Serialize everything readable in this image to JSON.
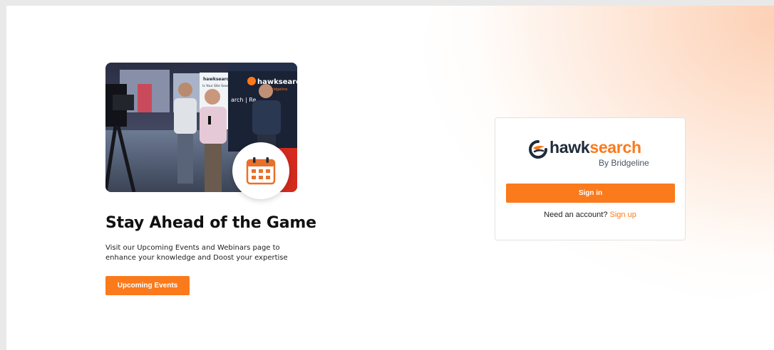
{
  "promo": {
    "title": "Stay Ahead of the Game",
    "description": "Visit our Upcoming Events and Webinars page to enhance your knowledge and Doost your expertise",
    "button_label": "Upcoming Events",
    "photo_booth_brand": "hawksearch",
    "photo_booth_sub": "By Bridgeline",
    "photo_sign_text": "Is Your Site Search Relevant?",
    "photo_banner_text": "arch | Re",
    "badge_icon": "calendar-icon"
  },
  "login": {
    "logo_word_left": "hawk",
    "logo_word_right": "search",
    "logo_sub": "By Bridgeline",
    "signin_label": "Sign in",
    "account_prompt": "Need an account?",
    "signup_label": "Sign up"
  },
  "colors": {
    "accent": "#fb7a1c",
    "logo_dark": "#1f2a3a",
    "glow": "#fbaa78",
    "frame": "#e9e9e9"
  }
}
